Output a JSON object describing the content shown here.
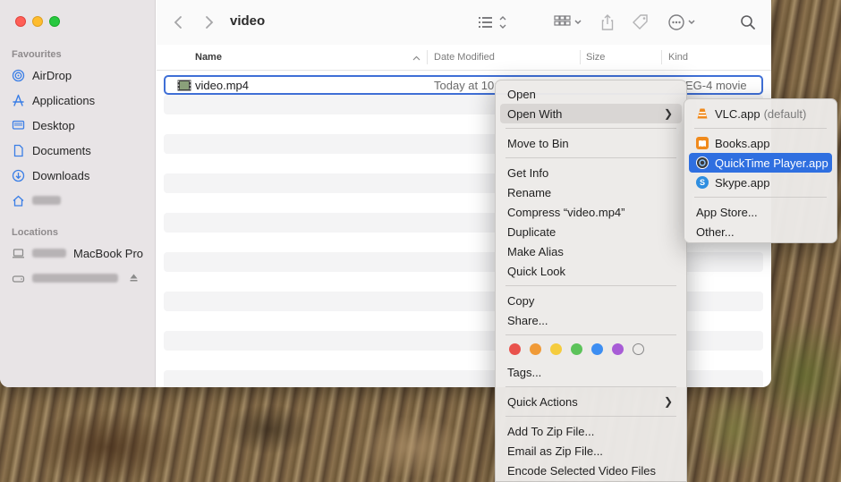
{
  "window": {
    "title": "video"
  },
  "sidebar": {
    "favourites_heading": "Favourites",
    "favourites": [
      {
        "label": "AirDrop",
        "icon": "airdrop-icon"
      },
      {
        "label": "Applications",
        "icon": "applications-icon"
      },
      {
        "label": "Desktop",
        "icon": "desktop-icon"
      },
      {
        "label": "Documents",
        "icon": "document-icon"
      },
      {
        "label": "Downloads",
        "icon": "downloads-icon"
      }
    ],
    "locations_heading": "Locations",
    "locations": [
      {
        "label": "MacBook Pro",
        "icon": "laptop-icon"
      }
    ]
  },
  "columns": {
    "name": "Name",
    "date": "Date Modified",
    "size": "Size",
    "kind": "Kind"
  },
  "file": {
    "name": "video.mp4",
    "date": "Today at 10:",
    "kind": "EG-4 movie"
  },
  "context_menu": {
    "items": [
      "Open",
      "Open With",
      "Move to Bin",
      "Get Info",
      "Rename",
      "Compress “video.mp4”",
      "Duplicate",
      "Make Alias",
      "Quick Look",
      "Copy",
      "Share...",
      "Tags...",
      "Quick Actions",
      "Add To Zip File...",
      "Email as Zip File...",
      "Encode Selected Video Files"
    ],
    "tag_colors": [
      "#e9524c",
      "#f09a37",
      "#f5cc3d",
      "#5cc35a",
      "#3d8ef2",
      "#a85cd6",
      "none"
    ]
  },
  "open_with_menu": {
    "default_app": "VLC.app",
    "default_suffix": "(default)",
    "apps": [
      "Books.app",
      "QuickTime Player.app",
      "Skype.app"
    ],
    "app_store": "App Store...",
    "other": "Other..."
  },
  "colors": {
    "selection": "#2f6fe0",
    "row_outline": "#3f6fd6"
  }
}
